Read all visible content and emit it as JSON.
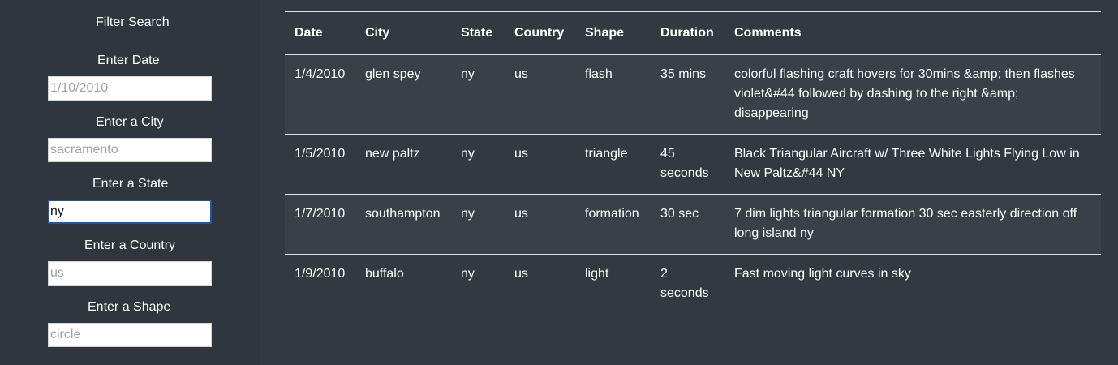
{
  "filters": {
    "title": "Filter Search",
    "date": {
      "label": "Enter Date",
      "placeholder": "1/10/2010",
      "value": ""
    },
    "city": {
      "label": "Enter a City",
      "placeholder": "sacramento",
      "value": ""
    },
    "state": {
      "label": "Enter a State",
      "placeholder": "",
      "value": "ny"
    },
    "country": {
      "label": "Enter a Country",
      "placeholder": "us",
      "value": ""
    },
    "shape": {
      "label": "Enter a Shape",
      "placeholder": "circle",
      "value": ""
    }
  },
  "table": {
    "headers": [
      "Date",
      "City",
      "State",
      "Country",
      "Shape",
      "Duration",
      "Comments"
    ],
    "rows": [
      [
        "1/4/2010",
        "glen spey",
        "ny",
        "us",
        "flash",
        "35 mins",
        "colorful flashing craft hovers for 30mins &amp; then flashes violet&#44 followed by dashing to the right &amp; disappearing"
      ],
      [
        "1/5/2010",
        "new paltz",
        "ny",
        "us",
        "triangle",
        "45 seconds",
        "Black Triangular Aircraft w/ Three White Lights Flying Low in New Paltz&#44 NY"
      ],
      [
        "1/7/2010",
        "southampton",
        "ny",
        "us",
        "formation",
        "30 sec",
        "7 dim lights triangular formation 30 sec easterly direction off long island ny"
      ],
      [
        "1/9/2010",
        "buffalo",
        "ny",
        "us",
        "light",
        "2 seconds",
        "Fast moving light curves in sky"
      ]
    ]
  },
  "colors": {
    "background": "#333941",
    "focus_border": "#1a55b6"
  }
}
